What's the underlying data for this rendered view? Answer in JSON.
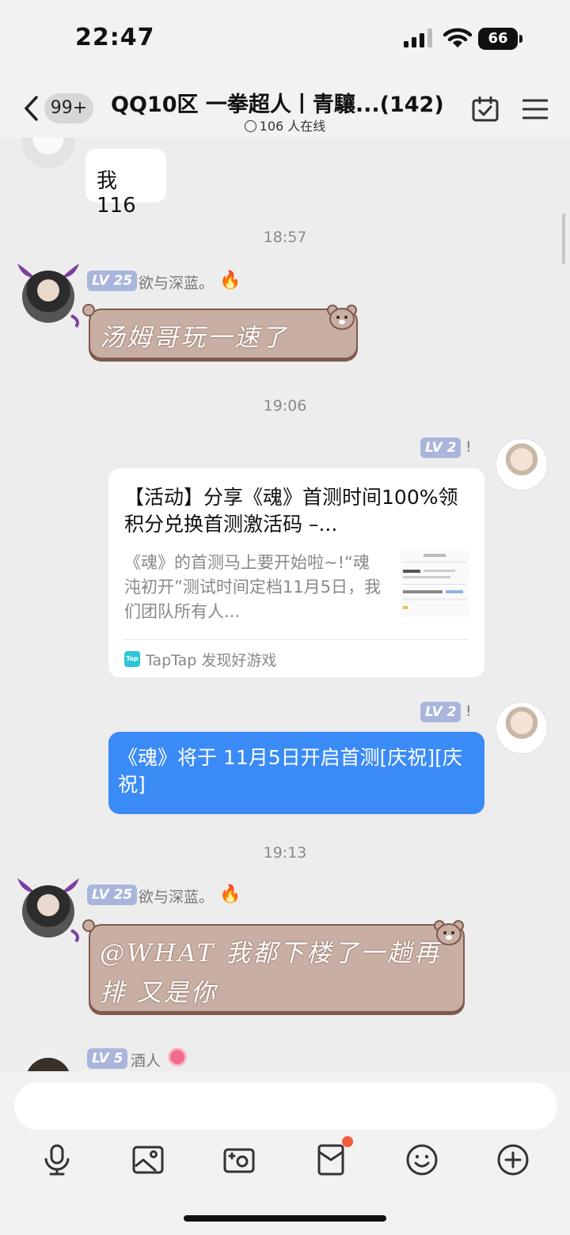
{
  "status_bar": {
    "time": "22:47",
    "battery": "66"
  },
  "nav": {
    "unread_count": "99+",
    "title": "QQ10区  一拳超人丨青驤...(142)",
    "online": "106 人在线"
  },
  "messages": {
    "m1": {
      "text": "我 116"
    },
    "ts1": "18:57",
    "m2": {
      "level": "LV 25",
      "nickname": "欲与深蓝。",
      "text": "汤姆哥玩一速了"
    },
    "ts2": "19:06",
    "m3": {
      "level": "LV 2",
      "mark": "!",
      "card_title": "【活动】分享《魂》首测时间100%领积分兑换首测激活码 –...",
      "card_desc": "《魂》的首测马上要开始啦~!“魂沌初开”测试时间定档11月5日，我们团队所有人...",
      "card_source_icon": "Tap",
      "card_source": "TapTap 发现好游戏"
    },
    "m4": {
      "level": "LV 2",
      "mark": "!",
      "text": "《魂》将于 11月5日开启首测[庆祝][庆祝]"
    },
    "ts3": "19:13",
    "m5": {
      "level": "LV 25",
      "nickname": "欲与深蓝。",
      "text": "@WHAT 我都下楼了一趟再排  又是你"
    },
    "m6": {
      "level": "LV 5",
      "nickname": "酒人"
    }
  },
  "input": {
    "placeholder": ""
  },
  "toolbar": [
    "mic-icon",
    "image-icon",
    "camera-icon",
    "red-packet-icon",
    "emoji-icon",
    "plus-icon"
  ],
  "colors": {
    "bubble_self": "#3b8bf7",
    "level_badge": "#a9b5db",
    "bear_bubble": "#c9afa3",
    "badge_dot": "#f25c3c"
  }
}
